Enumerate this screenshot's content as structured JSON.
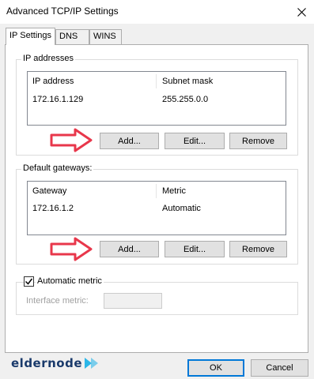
{
  "window": {
    "title": "Advanced TCP/IP Settings"
  },
  "tabs": [
    "IP Settings",
    "DNS",
    "WINS"
  ],
  "ip_addresses": {
    "group_label": "IP addresses",
    "columns": [
      "IP address",
      "Subnet mask"
    ],
    "rows": [
      {
        "ip": "172.16.1.129",
        "mask": "255.255.0.0"
      }
    ],
    "buttons": {
      "add": "Add...",
      "edit": "Edit...",
      "remove": "Remove"
    }
  },
  "gateways": {
    "group_label": "Default gateways:",
    "columns": [
      "Gateway",
      "Metric"
    ],
    "rows": [
      {
        "gateway": "172.16.1.2",
        "metric": "Automatic"
      }
    ],
    "buttons": {
      "add": "Add...",
      "edit": "Edit...",
      "remove": "Remove"
    }
  },
  "automatic_metric": {
    "label": "Automatic metric",
    "checked": true
  },
  "interface_metric": {
    "label": "Interface metric:",
    "value": ""
  },
  "footer": {
    "ok": "OK",
    "cancel": "Cancel"
  },
  "logo": {
    "text": "eldernode"
  },
  "colors": {
    "arrow": "#e8374b",
    "logo_text": "#1a3a6b",
    "logo_arrow": "#2bb6e8"
  }
}
